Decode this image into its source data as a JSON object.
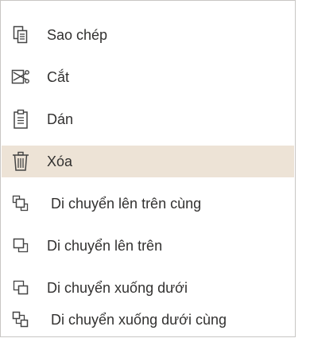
{
  "context_menu": {
    "highlight_color": "#ede3d6",
    "items": [
      {
        "id": "copy",
        "label": "Sao chép",
        "icon": "copy-icon",
        "highlighted": false
      },
      {
        "id": "cut",
        "label": "Cắt",
        "icon": "cut-icon",
        "highlighted": false
      },
      {
        "id": "paste",
        "label": "Dán",
        "icon": "paste-icon",
        "highlighted": false
      },
      {
        "id": "delete",
        "label": "Xóa",
        "icon": "trash-icon",
        "highlighted": true
      },
      {
        "id": "bring-to-front",
        "label": "Di chuyển lên trên cùng",
        "icon": "bring-to-front-icon",
        "highlighted": false
      },
      {
        "id": "bring-forward",
        "label": "Di chuyển lên trên",
        "icon": "bring-forward-icon",
        "highlighted": false
      },
      {
        "id": "send-backward",
        "label": "Di chuyển xuống dưới",
        "icon": "send-backward-icon",
        "highlighted": false
      },
      {
        "id": "send-to-back",
        "label": "Di chuyển xuống dưới cùng",
        "icon": "send-to-back-icon",
        "highlighted": false
      }
    ]
  }
}
